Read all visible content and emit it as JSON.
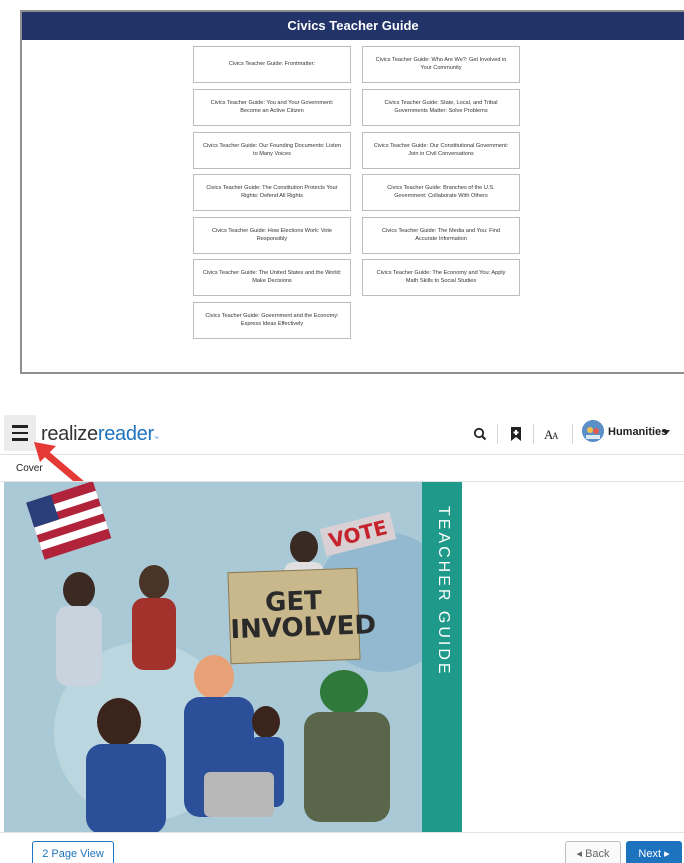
{
  "guide": {
    "title": "Civics Teacher Guide",
    "cards": [
      "Civics Teacher Guide: Frontmatter:",
      "Civics Teacher Guide: Who Are We?: Get Involved in Your Community",
      "Civics Teacher Guide: You and Your Government: Become an Active Citizen",
      "Civics Teacher Guide: State, Local, and Tribal Governments Matter: Solve Problems",
      "Civics Teacher Guide: Our Founding Documents: Listen to Many Voices",
      "Civics Teacher Guide: Our Constitutional Government: Join in Civil Conversations",
      "Civics Teacher Guide: The Constitution Protects Your Rights: Defend All Rights",
      "Civics Teacher Guide: Branches of the U.S. Government: Collaborate With Others",
      "Civics Teacher Guide: How Elections Work: Vote Responsibly",
      "Civics Teacher Guide: The Media and You: Find Accurate Information",
      "Civics Teacher Guide: The United States and the World: Make Decisions",
      "Civics Teacher Guide: The Economy and You: Apply Math Skills to Social Studies",
      "Civics Teacher Guide: Government and the Economy: Express Ideas Effectively"
    ]
  },
  "header": {
    "logo_part1": "realize",
    "logo_part2": "reader",
    "logo_tm": "™",
    "user_name": "Humanities",
    "icons": [
      "search-icon",
      "bookmark-icon",
      "text-size-icon",
      "avatar-icon",
      "menu-icon"
    ]
  },
  "breadcrumb": {
    "label": "Cover"
  },
  "cover": {
    "band_text": "TEACHER GUIDE",
    "sign_text_line1": "GET",
    "sign_text_line2": "INVOLVED",
    "vote_text": "VOTE",
    "band_color": "#1f9a8a"
  },
  "footer": {
    "two_page_label": "2 Page View",
    "back_label": "Back",
    "next_label": "Next"
  },
  "colors": {
    "guide_header": "#22336a",
    "accent": "#1e73be",
    "annotation_arrow": "#e53935"
  }
}
